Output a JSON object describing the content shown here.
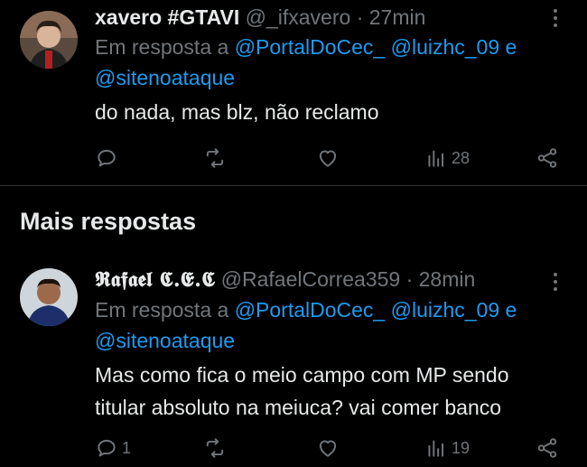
{
  "tweet1": {
    "name": "xavero #GTAVI",
    "handle": "@_ifxavero",
    "time": "· 27min",
    "reply_prefix": "Em resposta a",
    "mention1": "@PortalDoCec_",
    "mention2": "@luizhc_09",
    "reply_conj": "e",
    "mention3": "@sitenoataque",
    "text": "do nada, mas blz, não reclamo",
    "reply_count": "",
    "views": "28"
  },
  "section": {
    "title": "Mais respostas"
  },
  "tweet2": {
    "name": "𝕽𝖆𝖋𝖆𝖊𝖑 𝕮.𝕰.𝕮",
    "handle": "@RafaelCorrea359",
    "time": "· 28min",
    "reply_prefix": "Em resposta a",
    "mention1": "@PortalDoCec_",
    "mention2": "@luizhc_09",
    "reply_conj": "e",
    "mention3": "@sitenoataque",
    "text_line1": "Mas como fica o meio campo com MP sendo",
    "text_line2": "titular absoluto na meiuca? vai comer banco",
    "reply_count": "1",
    "views": "19"
  },
  "icons": [
    "reply-icon",
    "retweet-icon",
    "like-icon",
    "views-icon",
    "share-icon",
    "more-icon"
  ],
  "colors": {
    "background": "#000000",
    "text": "#e7e9ea",
    "muted": "#71767b",
    "link": "#1d9bf0",
    "divider": "#2f3336"
  }
}
